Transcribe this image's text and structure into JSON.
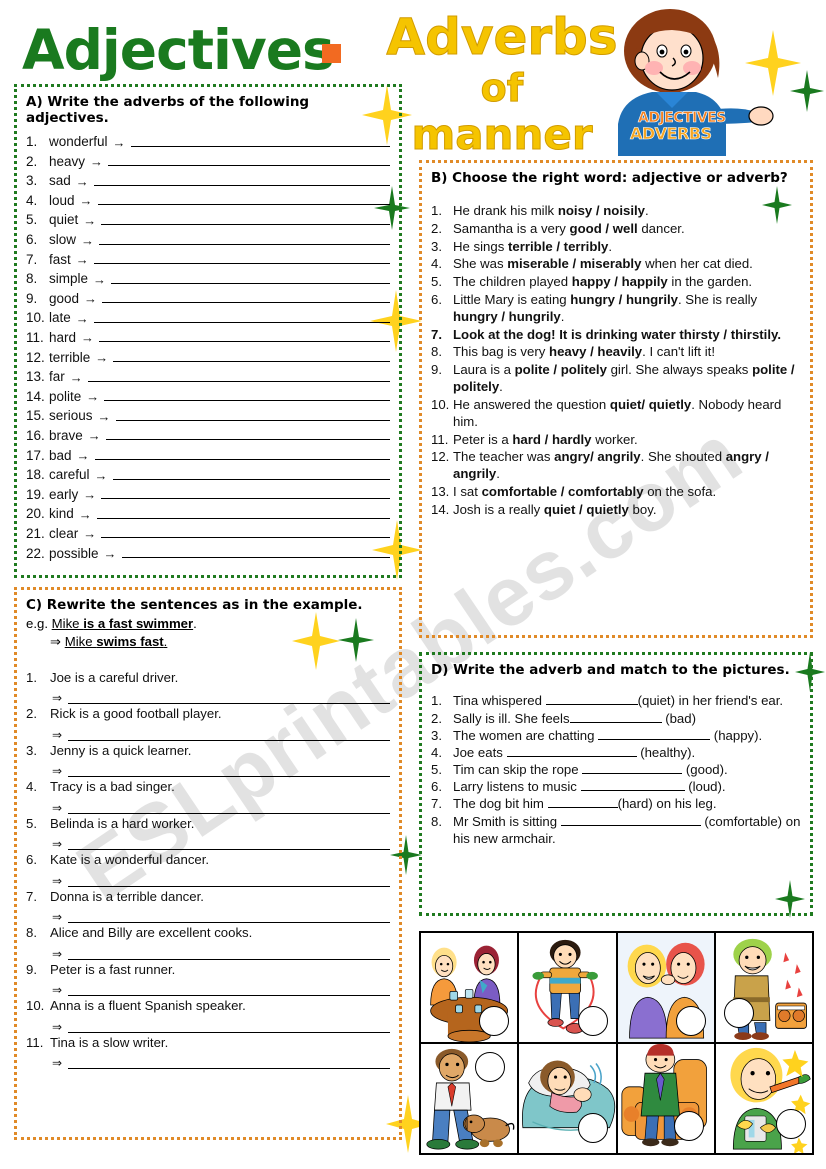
{
  "title": {
    "part1": "Adjectives",
    "part2": "Adverbs",
    "part3": "of",
    "part4": "manner",
    "badge_top": "ADJECTIVES",
    "badge_bottom": "ADVERBS",
    "colors": {
      "green": "#1a7a1f",
      "gold": "#f5c400",
      "orange_square": "#f26a21"
    }
  },
  "watermark": {
    "text": "ESLprintables.com"
  },
  "sectionA": {
    "heading": "A) Write the adverbs of the following adjectives.",
    "arrow": "→",
    "items": [
      {
        "n": "1.",
        "word": "wonderful"
      },
      {
        "n": "2.",
        "word": "heavy"
      },
      {
        "n": "3.",
        "word": "sad"
      },
      {
        "n": "4.",
        "word": "loud"
      },
      {
        "n": "5.",
        "word": "quiet"
      },
      {
        "n": "6.",
        "word": "slow"
      },
      {
        "n": "7.",
        "word": "fast"
      },
      {
        "n": "8.",
        "word": "simple"
      },
      {
        "n": "9.",
        "word": "good"
      },
      {
        "n": "10.",
        "word": "late"
      },
      {
        "n": "11.",
        "word": "hard"
      },
      {
        "n": "12.",
        "word": "terrible"
      },
      {
        "n": "13.",
        "word": "far"
      },
      {
        "n": "14.",
        "word": "polite"
      },
      {
        "n": "15.",
        "word": "serious"
      },
      {
        "n": "16.",
        "word": "brave"
      },
      {
        "n": "17.",
        "word": "bad"
      },
      {
        "n": "18.",
        "word": "careful"
      },
      {
        "n": "19.",
        "word": "early"
      },
      {
        "n": "20.",
        "word": "kind"
      },
      {
        "n": "21.",
        "word": "clear"
      },
      {
        "n": "22.",
        "word": "possible"
      }
    ]
  },
  "sectionB": {
    "heading": "B) Choose the right word: adjective or adverb?",
    "items": [
      {
        "n": "1.",
        "html": "He drank his milk <b>noisy / noisily</b>."
      },
      {
        "n": "2.",
        "html": "Samantha is a very <b>good / well</b> dancer."
      },
      {
        "n": "3.",
        "html": "He sings <b>terrible / terribly</b>."
      },
      {
        "n": "4.",
        "html": "She was <b>miserable / miserably</b> when her cat died."
      },
      {
        "n": "5.",
        "html": "The children played <b>happy / happily</b> in the garden."
      },
      {
        "n": "6.",
        "html": "Little Mary is eating <b>hungry / hungrily</b>. She is really <b>hungry / hungrily</b>."
      },
      {
        "n": "7.",
        "html": "Look at the dog! It is drinking water <b>thirsty / thirstily.</b>",
        "all_bold": true
      },
      {
        "n": "8.",
        "html": "This bag is very <b>heavy / heavily</b>. I can't lift it!"
      },
      {
        "n": "9.",
        "html": "Laura is a <b>polite / politely</b> girl. She always speaks <b>polite / politely</b>."
      },
      {
        "n": "10.",
        "html": "He answered the question <b>quiet/ quietly</b>. Nobody heard him."
      },
      {
        "n": "11.",
        "html": "Peter is a <b>hard / hardly</b> worker."
      },
      {
        "n": "12.",
        "html": "The teacher was <b>angry/ angrily</b>. She shouted <b>angry / angrily</b>."
      },
      {
        "n": "13.",
        "html": "I sat <b>comfortable / comfortably</b> on the sofa."
      },
      {
        "n": "14.",
        "html": "Josh is a really <b>quiet / quietly</b> boy."
      }
    ]
  },
  "sectionC": {
    "heading": "C) Rewrite the sentences as in the example.",
    "example_line1": "e.g. <span class=\"u\">Mike <b>is a fast swimmer</b></span>.",
    "example_line2": "⇒ <span class=\"u\">Mike <b>swims fast</b>.</span>",
    "arrow": "⇒",
    "items": [
      {
        "n": "1.",
        "sentence": "Joe is a careful driver."
      },
      {
        "n": "2.",
        "sentence": "Rick is a good football player."
      },
      {
        "n": "3.",
        "sentence": "Jenny is a quick learner."
      },
      {
        "n": "4.",
        "sentence": "Tracy is a bad singer."
      },
      {
        "n": "5.",
        "sentence": "Belinda is a hard worker."
      },
      {
        "n": "6.",
        "sentence": "Kate is a wonderful dancer."
      },
      {
        "n": "7.",
        "sentence": "Donna is a terrible dancer."
      },
      {
        "n": "8.",
        "sentence": "Alice and Billy are excellent cooks."
      },
      {
        "n": "9.",
        "sentence": "Peter is a fast runner."
      },
      {
        "n": "10.",
        "sentence": "Anna is a fluent Spanish speaker."
      },
      {
        "n": "11.",
        "sentence": "Tina is a slow writer."
      }
    ]
  },
  "sectionD": {
    "heading": "D) Write the adverb and match to the pictures.",
    "items": [
      {
        "n": "1.",
        "html": "Tina whispered <span class=\"ul-blank\" style=\"width:92px\"></span>(quiet) in her friend's ear."
      },
      {
        "n": "2.",
        "html": "Sally is ill. She feels<span class=\"ul-blank\" style=\"width:92px\"></span> (bad)"
      },
      {
        "n": "3.",
        "html": "The women are chatting <span class=\"ul-blank\" style=\"width:112px\"></span> (happy)."
      },
      {
        "n": "4.",
        "html": "Joe eats <span class=\"ul-blank\" style=\"width:130px\"></span> (healthy)."
      },
      {
        "n": "5.",
        "html": "Tim can skip the rope <span class=\"ul-blank\" style=\"width:100px\"></span> (good)."
      },
      {
        "n": "6.",
        "html": "Larry listens to music <span class=\"ul-blank\" style=\"width:104px\"></span> (loud)."
      },
      {
        "n": "7.",
        "html": "The dog bit him <span class=\"ul-blank\" style=\"width:70px\"></span>(hard) on his leg."
      },
      {
        "n": "8.",
        "html": "Mr Smith is sitting <span class=\"ul-blank\" style=\"width:140px\"></span> (comfortable) on his new armchair."
      }
    ]
  },
  "pictures": {
    "cells": [
      {
        "name": "women-chatting-at-table"
      },
      {
        "name": "boy-skipping-rope"
      },
      {
        "name": "two-women-whispering"
      },
      {
        "name": "boy-listening-to-music"
      },
      {
        "name": "man-bitten-by-dog"
      },
      {
        "name": "sick-girl-in-bed"
      },
      {
        "name": "man-sitting-in-armchair"
      },
      {
        "name": "boy-eating-carrot"
      }
    ]
  }
}
